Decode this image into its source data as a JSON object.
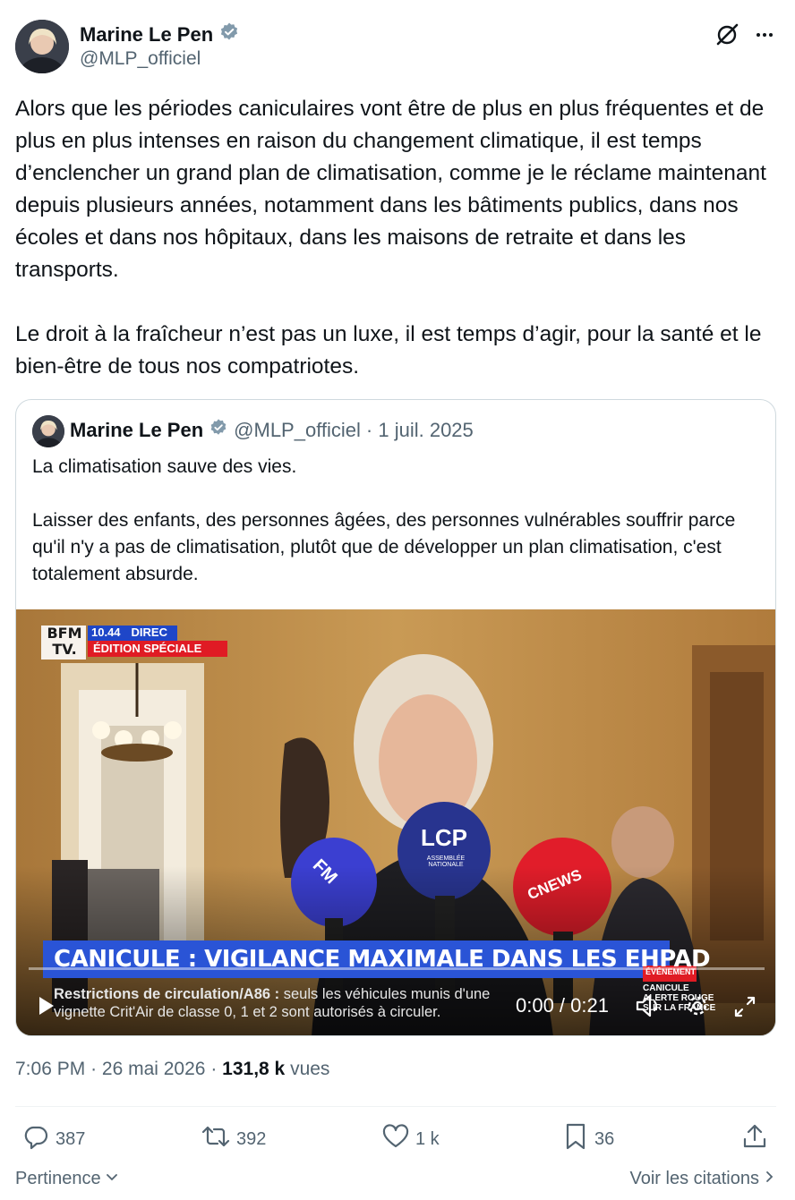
{
  "author": {
    "name": "Marine Le Pen",
    "handle": "@MLP_officiel"
  },
  "tweet": {
    "paragraph1": "Alors que les périodes caniculaires vont être de plus en plus fréquentes et de plus en plus intenses en raison du changement climatique, il est temps d’enclencher un grand plan de climatisation, comme je le réclame maintenant depuis plusieurs années, notamment dans les bâtiments publics, dans nos écoles et dans nos hôpitaux, dans les maisons de retraite et dans les transports.",
    "paragraph2": "Le droit à la fraîcheur n’est pas un luxe, il est temps d’agir, pour la santé et le bien-être de tous nos compatriotes."
  },
  "quote": {
    "name": "Marine Le Pen",
    "handle": "@MLP_officiel",
    "date": "· 1 juil. 2025",
    "paragraph1": "La climatisation sauve des vies.",
    "paragraph2": "Laisser des enfants, des personnes âgées, des personnes vulnérables souffrir parce qu'il n'y a pas de climatisation, plutôt que de développer un plan climatisation, c'est totalement absurde.",
    "video": {
      "channel_logo_line1": "BFM",
      "channel_logo_line2": "TV.",
      "clock": "10.44",
      "live_tag": "DIREC",
      "edition": "ÉDITION SPÉCIALE",
      "headline": "CANICULE : VIGILANCE MAXIMALE DANS LES EHPAD",
      "ticker_bold": "Restrictions de circulation/A86 :",
      "ticker_line1": "seuls les véhicules munis d'une",
      "ticker_line2": "vignette Crit'Air de classe 0, 1 et 2 sont autorisés à circuler.",
      "event_tag": "ÉVÉNEMENT",
      "event_line1": "CANICULE",
      "event_line2": "ALERTE ROUGE",
      "event_line3": "SUR LA FRANCE",
      "mic1": "LCP",
      "mic1_sub": "ASSEMBLÉE NATIONALE",
      "mic2": "CNEWS",
      "mic3": "FM",
      "time_display": "0:00 / 0:21",
      "progress": 0
    }
  },
  "meta": {
    "time": "7:06 PM",
    "date": "26 mai 2026",
    "views_count": "131,8 k",
    "views_label": "vues"
  },
  "actions": {
    "replies": "387",
    "reposts": "392",
    "likes": "1 k",
    "bookmarks": "36"
  },
  "footer": {
    "sort_label": "Pertinence",
    "quotes_link": "Voir les citations"
  },
  "colors": {
    "verified": "#829aab",
    "text": "#0f1419",
    "secondary": "#536471"
  }
}
